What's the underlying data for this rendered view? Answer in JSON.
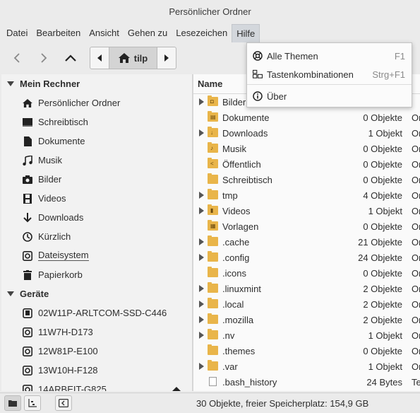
{
  "window": {
    "title": "Persönlicher Ordner"
  },
  "menubar": {
    "items": [
      "Datei",
      "Bearbeiten",
      "Ansicht",
      "Gehen zu",
      "Lesezeichen",
      "Hilfe"
    ],
    "active": "Hilfe"
  },
  "pathbar": {
    "current": "tilp"
  },
  "sidebar": {
    "sections": [
      {
        "title": "Mein Rechner",
        "items": [
          {
            "label": "Persönlicher Ordner",
            "icon": "home-icon"
          },
          {
            "label": "Schreibtisch",
            "icon": "desktop-icon"
          },
          {
            "label": "Dokumente",
            "icon": "document-icon"
          },
          {
            "label": "Musik",
            "icon": "music-icon"
          },
          {
            "label": "Bilder",
            "icon": "camera-icon"
          },
          {
            "label": "Videos",
            "icon": "film-icon"
          },
          {
            "label": "Downloads",
            "icon": "download-icon"
          },
          {
            "label": "Kürzlich",
            "icon": "clock-icon"
          },
          {
            "label": "Dateisystem",
            "icon": "drive-icon"
          },
          {
            "label": "Papierkorb",
            "icon": "trash-icon"
          }
        ]
      },
      {
        "title": "Geräte",
        "items": [
          {
            "label": "02W11P-ARLTCOM-SSD-C446",
            "icon": "drive-icon"
          },
          {
            "label": "11W7H-D173",
            "icon": "drive-icon"
          },
          {
            "label": "12W81P-E100",
            "icon": "drive-icon"
          },
          {
            "label": "13W10H-F128",
            "icon": "drive-icon"
          },
          {
            "label": "14ARBEIT-G825",
            "icon": "drive-icon"
          }
        ]
      }
    ]
  },
  "filelist": {
    "column_name": "Name",
    "rows": [
      {
        "name": "Bilder",
        "size": "",
        "type": "",
        "expandable": true,
        "badge": "camera"
      },
      {
        "name": "Dokumente",
        "size": "0 Objekte",
        "type": "Or",
        "expandable": false,
        "badge": "doc"
      },
      {
        "name": "Downloads",
        "size": "1 Objekt",
        "type": "Or",
        "expandable": true,
        "badge": "download"
      },
      {
        "name": "Musik",
        "size": "0 Objekte",
        "type": "Or",
        "expandable": false,
        "badge": "music"
      },
      {
        "name": "Öffentlich",
        "size": "0 Objekte",
        "type": "Or",
        "expandable": false,
        "badge": "share"
      },
      {
        "name": "Schreibtisch",
        "size": "0 Objekte",
        "type": "Or",
        "expandable": false,
        "badge": ""
      },
      {
        "name": "tmp",
        "size": "4 Objekte",
        "type": "Or",
        "expandable": true,
        "badge": ""
      },
      {
        "name": "Videos",
        "size": "1 Objekt",
        "type": "Or",
        "expandable": true,
        "badge": "video"
      },
      {
        "name": "Vorlagen",
        "size": "0 Objekte",
        "type": "Or",
        "expandable": false,
        "badge": "template"
      },
      {
        "name": ".cache",
        "size": "21 Objekte",
        "type": "Or",
        "expandable": true,
        "badge": ""
      },
      {
        "name": ".config",
        "size": "24 Objekte",
        "type": "Or",
        "expandable": true,
        "badge": ""
      },
      {
        "name": ".icons",
        "size": "0 Objekte",
        "type": "Or",
        "expandable": false,
        "badge": ""
      },
      {
        "name": ".linuxmint",
        "size": "2 Objekte",
        "type": "Or",
        "expandable": true,
        "badge": ""
      },
      {
        "name": ".local",
        "size": "2 Objekte",
        "type": "Or",
        "expandable": true,
        "badge": ""
      },
      {
        "name": ".mozilla",
        "size": "2 Objekte",
        "type": "Or",
        "expandable": true,
        "badge": ""
      },
      {
        "name": ".nv",
        "size": "1 Objekt",
        "type": "Or",
        "expandable": true,
        "badge": ""
      },
      {
        "name": ".themes",
        "size": "0 Objekte",
        "type": "Or",
        "expandable": false,
        "badge": ""
      },
      {
        "name": ".var",
        "size": "1 Objekt",
        "type": "Or",
        "expandable": true,
        "badge": ""
      },
      {
        "name": ".bash_history",
        "size": "24 Bytes",
        "type": "Te",
        "expandable": false,
        "badge": "file"
      }
    ]
  },
  "help_menu": {
    "items": [
      {
        "label": "Alle Themen",
        "accel": "F1",
        "icon": "help-topics-icon"
      },
      {
        "label": "Tastenkombinationen",
        "accel": "Strg+F1",
        "icon": "keyboard-shortcuts-icon"
      },
      {
        "label": "Über",
        "accel": "",
        "icon": "info-icon"
      }
    ]
  },
  "statusbar": {
    "text": "30 Objekte, freier Speicherplatz: 154,9 GB"
  },
  "colors": {
    "folder": "#e9b54a",
    "accent_menu": "#d3d7dc"
  }
}
